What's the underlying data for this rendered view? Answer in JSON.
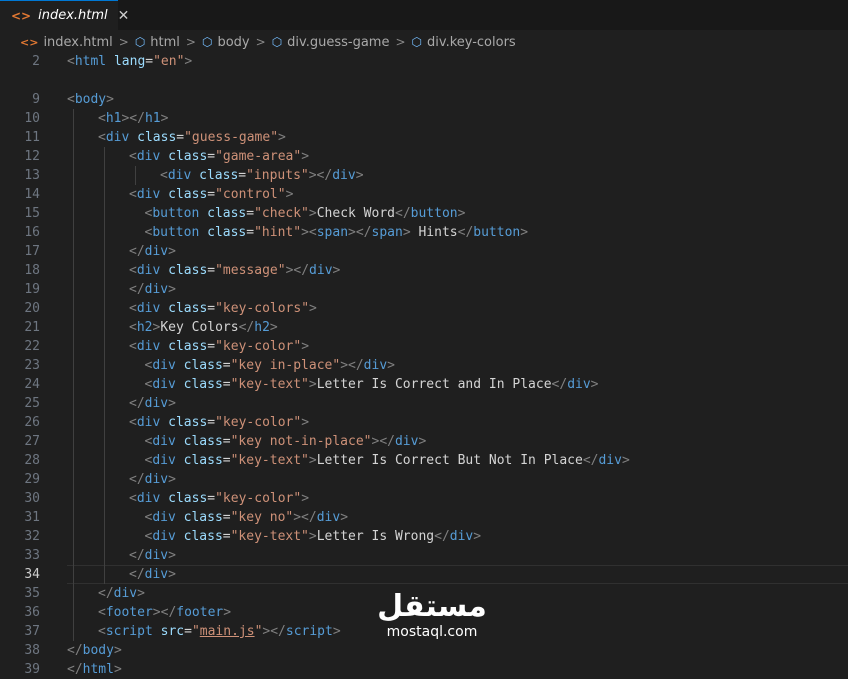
{
  "tab": {
    "label": "index.html",
    "close": "✕",
    "file_icon": "<>"
  },
  "breadcrumb": [
    "index.html",
    "html",
    "body",
    "div.guess-game",
    "div.key-colors"
  ],
  "current_line": 34,
  "lines": [
    {
      "n": "2",
      "indent": 0,
      "tokens": [
        [
          "p",
          "<"
        ],
        [
          "t",
          "html"
        ],
        [
          "x",
          " "
        ],
        [
          "a",
          "lang"
        ],
        [
          "x",
          "="
        ],
        [
          "s",
          "\"en\""
        ],
        [
          "p",
          ">"
        ]
      ]
    },
    {
      "n": "",
      "indent": 0,
      "tokens": []
    },
    {
      "n": "9",
      "indent": 0,
      "tokens": [
        [
          "p",
          "<"
        ],
        [
          "t",
          "body"
        ],
        [
          "p",
          ">"
        ]
      ]
    },
    {
      "n": "10",
      "indent": 1,
      "tokens": [
        [
          "p",
          "<"
        ],
        [
          "t",
          "h1"
        ],
        [
          "p",
          "></"
        ],
        [
          "t",
          "h1"
        ],
        [
          "p",
          ">"
        ]
      ]
    },
    {
      "n": "11",
      "indent": 1,
      "tokens": [
        [
          "p",
          "<"
        ],
        [
          "t",
          "div"
        ],
        [
          "x",
          " "
        ],
        [
          "a",
          "class"
        ],
        [
          "x",
          "="
        ],
        [
          "s",
          "\"guess-game\""
        ],
        [
          "p",
          ">"
        ]
      ]
    },
    {
      "n": "12",
      "indent": 2,
      "tokens": [
        [
          "p",
          "<"
        ],
        [
          "t",
          "div"
        ],
        [
          "x",
          " "
        ],
        [
          "a",
          "class"
        ],
        [
          "x",
          "="
        ],
        [
          "s",
          "\"game-area\""
        ],
        [
          "p",
          ">"
        ]
      ]
    },
    {
      "n": "13",
      "indent": 3,
      "tokens": [
        [
          "p",
          "<"
        ],
        [
          "t",
          "div"
        ],
        [
          "x",
          " "
        ],
        [
          "a",
          "class"
        ],
        [
          "x",
          "="
        ],
        [
          "s",
          "\"inputs\""
        ],
        [
          "p",
          "></"
        ],
        [
          "t",
          "div"
        ],
        [
          "p",
          ">"
        ]
      ]
    },
    {
      "n": "14",
      "indent": 2,
      "tokens": [
        [
          "p",
          "<"
        ],
        [
          "t",
          "div"
        ],
        [
          "x",
          " "
        ],
        [
          "a",
          "class"
        ],
        [
          "x",
          "="
        ],
        [
          "s",
          "\"control\""
        ],
        [
          "p",
          ">"
        ]
      ]
    },
    {
      "n": "15",
      "indent": 2.5,
      "tokens": [
        [
          "p",
          "<"
        ],
        [
          "t",
          "button"
        ],
        [
          "x",
          " "
        ],
        [
          "a",
          "class"
        ],
        [
          "x",
          "="
        ],
        [
          "s",
          "\"check\""
        ],
        [
          "p",
          ">"
        ],
        [
          "x",
          "Check Word"
        ],
        [
          "p",
          "</"
        ],
        [
          "t",
          "button"
        ],
        [
          "p",
          ">"
        ]
      ]
    },
    {
      "n": "16",
      "indent": 2.5,
      "tokens": [
        [
          "p",
          "<"
        ],
        [
          "t",
          "button"
        ],
        [
          "x",
          " "
        ],
        [
          "a",
          "class"
        ],
        [
          "x",
          "="
        ],
        [
          "s",
          "\"hint\""
        ],
        [
          "p",
          "><"
        ],
        [
          "t",
          "span"
        ],
        [
          "p",
          "></"
        ],
        [
          "t",
          "span"
        ],
        [
          "p",
          ">"
        ],
        [
          "x",
          " Hints"
        ],
        [
          "p",
          "</"
        ],
        [
          "t",
          "button"
        ],
        [
          "p",
          ">"
        ]
      ]
    },
    {
      "n": "17",
      "indent": 2,
      "tokens": [
        [
          "p",
          "</"
        ],
        [
          "t",
          "div"
        ],
        [
          "p",
          ">"
        ]
      ]
    },
    {
      "n": "18",
      "indent": 2,
      "tokens": [
        [
          "p",
          "<"
        ],
        [
          "t",
          "div"
        ],
        [
          "x",
          " "
        ],
        [
          "a",
          "class"
        ],
        [
          "x",
          "="
        ],
        [
          "s",
          "\"message\""
        ],
        [
          "p",
          "></"
        ],
        [
          "t",
          "div"
        ],
        [
          "p",
          ">"
        ]
      ]
    },
    {
      "n": "19",
      "indent": 2,
      "tokens": [
        [
          "p",
          "</"
        ],
        [
          "t",
          "div"
        ],
        [
          "p",
          ">"
        ]
      ]
    },
    {
      "n": "20",
      "indent": 2,
      "tokens": [
        [
          "p",
          "<"
        ],
        [
          "t",
          "div"
        ],
        [
          "x",
          " "
        ],
        [
          "a",
          "class"
        ],
        [
          "x",
          "="
        ],
        [
          "s",
          "\"key-colors\""
        ],
        [
          "p",
          ">"
        ]
      ]
    },
    {
      "n": "21",
      "indent": 2,
      "tokens": [
        [
          "p",
          "<"
        ],
        [
          "t",
          "h2"
        ],
        [
          "p",
          ">"
        ],
        [
          "x",
          "Key Colors"
        ],
        [
          "p",
          "</"
        ],
        [
          "t",
          "h2"
        ],
        [
          "p",
          ">"
        ]
      ]
    },
    {
      "n": "22",
      "indent": 2,
      "tokens": [
        [
          "p",
          "<"
        ],
        [
          "t",
          "div"
        ],
        [
          "x",
          " "
        ],
        [
          "a",
          "class"
        ],
        [
          "x",
          "="
        ],
        [
          "s",
          "\"key-color\""
        ],
        [
          "p",
          ">"
        ]
      ]
    },
    {
      "n": "23",
      "indent": 2.5,
      "tokens": [
        [
          "p",
          "<"
        ],
        [
          "t",
          "div"
        ],
        [
          "x",
          " "
        ],
        [
          "a",
          "class"
        ],
        [
          "x",
          "="
        ],
        [
          "s",
          "\"key in-place\""
        ],
        [
          "p",
          "></"
        ],
        [
          "t",
          "div"
        ],
        [
          "p",
          ">"
        ]
      ]
    },
    {
      "n": "24",
      "indent": 2.5,
      "tokens": [
        [
          "p",
          "<"
        ],
        [
          "t",
          "div"
        ],
        [
          "x",
          " "
        ],
        [
          "a",
          "class"
        ],
        [
          "x",
          "="
        ],
        [
          "s",
          "\"key-text\""
        ],
        [
          "p",
          ">"
        ],
        [
          "x",
          "Letter Is Correct and In Place"
        ],
        [
          "p",
          "</"
        ],
        [
          "t",
          "div"
        ],
        [
          "p",
          ">"
        ]
      ]
    },
    {
      "n": "25",
      "indent": 2,
      "tokens": [
        [
          "p",
          "</"
        ],
        [
          "t",
          "div"
        ],
        [
          "p",
          ">"
        ]
      ]
    },
    {
      "n": "26",
      "indent": 2,
      "tokens": [
        [
          "p",
          "<"
        ],
        [
          "t",
          "div"
        ],
        [
          "x",
          " "
        ],
        [
          "a",
          "class"
        ],
        [
          "x",
          "="
        ],
        [
          "s",
          "\"key-color\""
        ],
        [
          "p",
          ">"
        ]
      ]
    },
    {
      "n": "27",
      "indent": 2.5,
      "tokens": [
        [
          "p",
          "<"
        ],
        [
          "t",
          "div"
        ],
        [
          "x",
          " "
        ],
        [
          "a",
          "class"
        ],
        [
          "x",
          "="
        ],
        [
          "s",
          "\"key not-in-place\""
        ],
        [
          "p",
          "></"
        ],
        [
          "t",
          "div"
        ],
        [
          "p",
          ">"
        ]
      ]
    },
    {
      "n": "28",
      "indent": 2.5,
      "tokens": [
        [
          "p",
          "<"
        ],
        [
          "t",
          "div"
        ],
        [
          "x",
          " "
        ],
        [
          "a",
          "class"
        ],
        [
          "x",
          "="
        ],
        [
          "s",
          "\"key-text\""
        ],
        [
          "p",
          ">"
        ],
        [
          "x",
          "Letter Is Correct But Not In Place"
        ],
        [
          "p",
          "</"
        ],
        [
          "t",
          "div"
        ],
        [
          "p",
          ">"
        ]
      ]
    },
    {
      "n": "29",
      "indent": 2,
      "tokens": [
        [
          "p",
          "</"
        ],
        [
          "t",
          "div"
        ],
        [
          "p",
          ">"
        ]
      ]
    },
    {
      "n": "30",
      "indent": 2,
      "tokens": [
        [
          "p",
          "<"
        ],
        [
          "t",
          "div"
        ],
        [
          "x",
          " "
        ],
        [
          "a",
          "class"
        ],
        [
          "x",
          "="
        ],
        [
          "s",
          "\"key-color\""
        ],
        [
          "p",
          ">"
        ]
      ]
    },
    {
      "n": "31",
      "indent": 2.5,
      "tokens": [
        [
          "p",
          "<"
        ],
        [
          "t",
          "div"
        ],
        [
          "x",
          " "
        ],
        [
          "a",
          "class"
        ],
        [
          "x",
          "="
        ],
        [
          "s",
          "\"key no\""
        ],
        [
          "p",
          "></"
        ],
        [
          "t",
          "div"
        ],
        [
          "p",
          ">"
        ]
      ]
    },
    {
      "n": "32",
      "indent": 2.5,
      "tokens": [
        [
          "p",
          "<"
        ],
        [
          "t",
          "div"
        ],
        [
          "x",
          " "
        ],
        [
          "a",
          "class"
        ],
        [
          "x",
          "="
        ],
        [
          "s",
          "\"key-text\""
        ],
        [
          "p",
          ">"
        ],
        [
          "x",
          "Letter Is Wrong"
        ],
        [
          "p",
          "</"
        ],
        [
          "t",
          "div"
        ],
        [
          "p",
          ">"
        ]
      ]
    },
    {
      "n": "33",
      "indent": 2,
      "tokens": [
        [
          "p",
          "</"
        ],
        [
          "t",
          "div"
        ],
        [
          "p",
          ">"
        ]
      ]
    },
    {
      "n": "34",
      "indent": 2,
      "tokens": [
        [
          "p",
          "</"
        ],
        [
          "t",
          "div"
        ],
        [
          "p",
          ">"
        ]
      ]
    },
    {
      "n": "35",
      "indent": 1,
      "tokens": [
        [
          "p",
          "</"
        ],
        [
          "t",
          "div"
        ],
        [
          "p",
          ">"
        ]
      ]
    },
    {
      "n": "36",
      "indent": 1,
      "tokens": [
        [
          "p",
          "<"
        ],
        [
          "t",
          "footer"
        ],
        [
          "p",
          "></"
        ],
        [
          "t",
          "footer"
        ],
        [
          "p",
          ">"
        ]
      ]
    },
    {
      "n": "37",
      "indent": 1,
      "tokens": [
        [
          "p",
          "<"
        ],
        [
          "t",
          "script"
        ],
        [
          "x",
          " "
        ],
        [
          "a",
          "src"
        ],
        [
          "x",
          "="
        ],
        [
          "s",
          "\""
        ],
        [
          "su",
          "main.js"
        ],
        [
          "s",
          "\""
        ],
        [
          "p",
          "></"
        ],
        [
          "t",
          "script"
        ],
        [
          "p",
          ">"
        ]
      ]
    },
    {
      "n": "38",
      "indent": 0,
      "tokens": [
        [
          "p",
          "</"
        ],
        [
          "t",
          "body"
        ],
        [
          "p",
          ">"
        ]
      ]
    },
    {
      "n": "39",
      "indent": 0,
      "tokens": [
        [
          "p",
          "</"
        ],
        [
          "t",
          "html"
        ],
        [
          "p",
          ">"
        ]
      ]
    }
  ],
  "watermark": {
    "logo": "مستقل",
    "text": "mostaql.com"
  }
}
